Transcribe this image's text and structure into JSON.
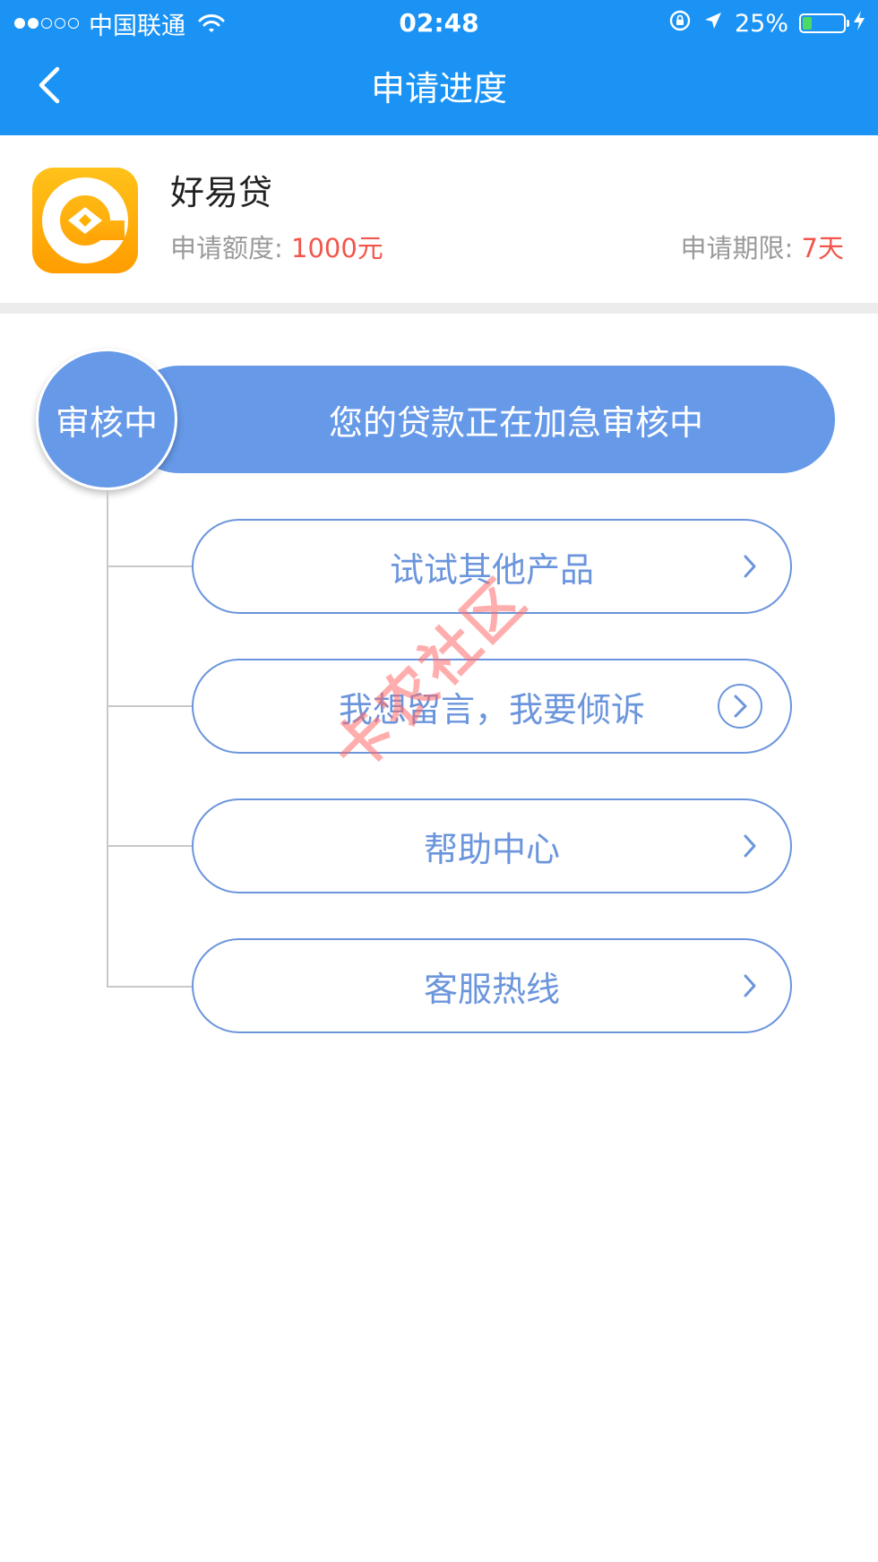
{
  "status_bar": {
    "carrier": "中国联通",
    "time": "02:48",
    "battery": "25%"
  },
  "nav": {
    "title": "申请进度"
  },
  "product": {
    "name": "好易贷",
    "amount_label": "申请额度:",
    "amount_value": "1000元",
    "term_label": "申请期限:",
    "term_value": "7天"
  },
  "status": {
    "badge": "审核中",
    "message": "您的贷款正在加急审核中"
  },
  "actions": [
    {
      "label": "试试其他产品"
    },
    {
      "label": "我想留言，我要倾诉"
    },
    {
      "label": "帮助中心"
    },
    {
      "label": "客服热线"
    }
  ],
  "watermark": "卡农社区",
  "colors": {
    "header": "#1b93f5",
    "status_fill": "#6699e8",
    "button_border": "#6b95dc",
    "accent_red": "#f2554b",
    "logo_orange": "#ffa800"
  }
}
